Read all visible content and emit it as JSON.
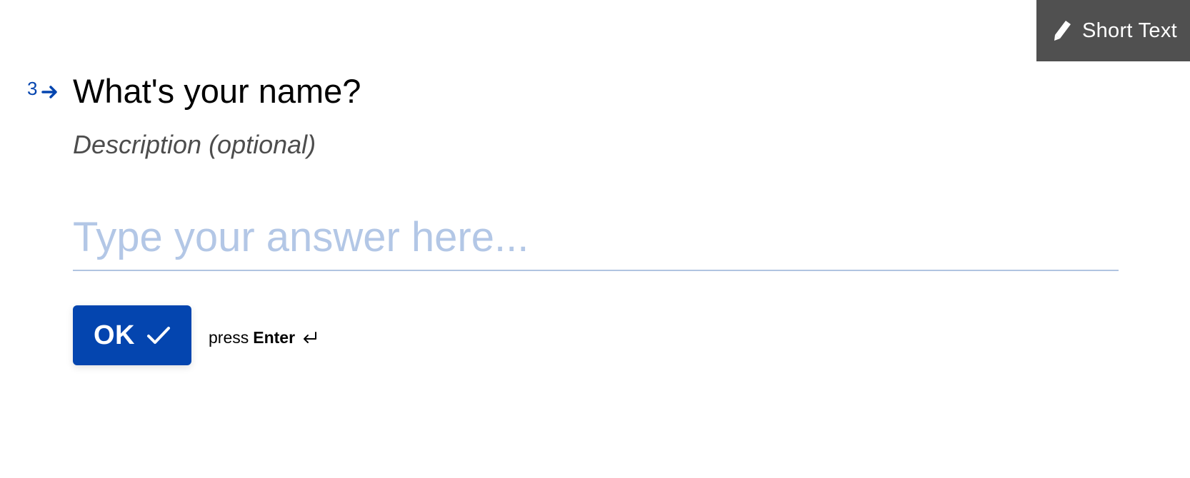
{
  "badge": {
    "label": "Short Text",
    "icon": "pencil-icon",
    "background": "#505050"
  },
  "question": {
    "number": "3",
    "arrow_icon": "arrow-right-icon",
    "title": "What's your name?",
    "description": "Description (optional)"
  },
  "answer": {
    "value": "",
    "placeholder": "Type your answer here..."
  },
  "actions": {
    "ok_label": "OK",
    "ok_icon": "check-icon",
    "hint_prefix": "press",
    "hint_key": "Enter",
    "hint_icon": "enter-return-icon"
  },
  "colors": {
    "accent": "#0445AF",
    "placeholder": "#B3C7E6",
    "underline": "#B0C4E1"
  }
}
